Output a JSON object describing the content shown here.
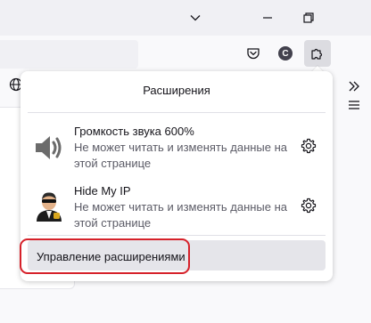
{
  "titlebar": {
    "buttons": [
      {
        "name": "tab-list",
        "icon": "chevron-down-icon"
      },
      {
        "name": "minimize",
        "icon": "minimize-icon"
      },
      {
        "name": "restore",
        "icon": "restore-icon"
      }
    ]
  },
  "toolbar": {
    "pocket_icon": "pocket-icon",
    "account_badge": "C",
    "extensions_icon": "puzzle-piece-icon"
  },
  "panel": {
    "title": "Расширения",
    "extensions": [
      {
        "name": "Громкость звука 600%",
        "description": "Не может читать и изменять данные на этой странице",
        "icon": "speaker-icon"
      },
      {
        "name": "Hide My IP",
        "description": "Не может читать и изменять данные на этой странице",
        "icon": "agent-avatar-icon"
      }
    ],
    "manage_label": "Управление расширениями"
  },
  "colors": {
    "highlight": "#d6212a",
    "panel_bg": "#ffffff",
    "chrome_bg": "#f0f0f4"
  }
}
